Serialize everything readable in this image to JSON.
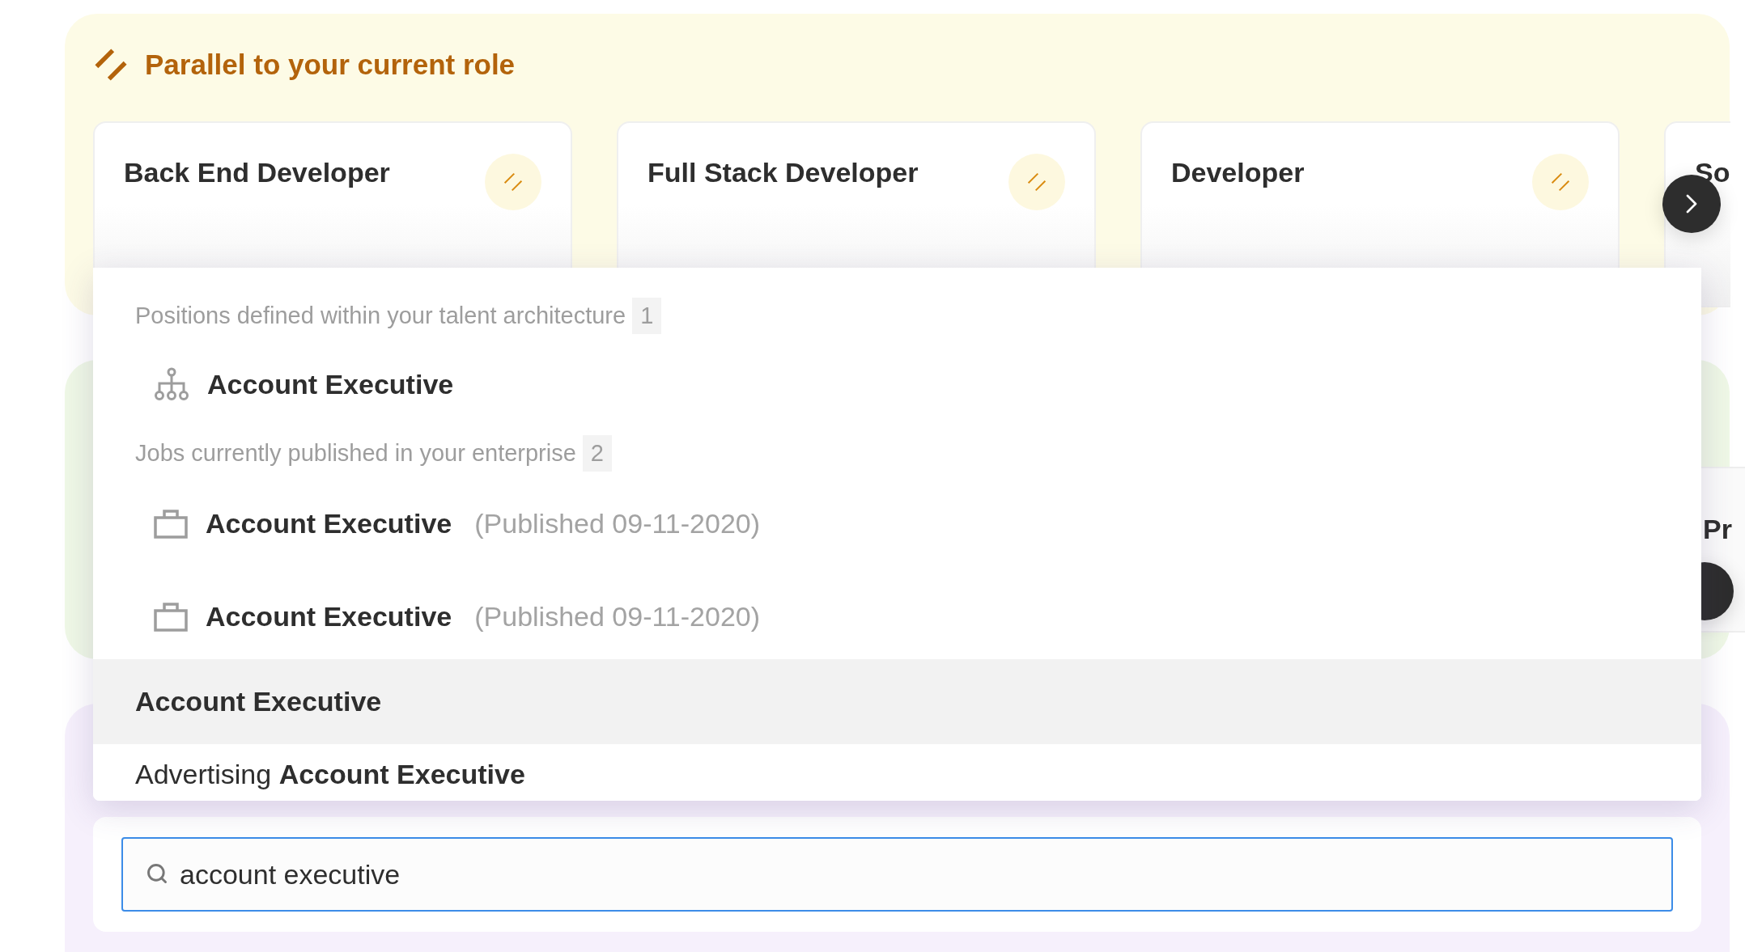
{
  "parallel_section": {
    "title": "Parallel to your current role",
    "cards": [
      {
        "title": "Back End Developer"
      },
      {
        "title": "Full Stack Developer"
      },
      {
        "title": "Developer"
      },
      {
        "title": "So"
      }
    ]
  },
  "second_section": {
    "cards": [
      {
        "title": "Pr"
      }
    ]
  },
  "dropdown": {
    "groups": [
      {
        "kind": "position",
        "heading": "Positions defined within your talent architecture",
        "count": "1",
        "items": [
          {
            "title": "Account Executive"
          }
        ]
      },
      {
        "kind": "job",
        "heading": "Jobs currently published in your enterprise",
        "count": "2",
        "items": [
          {
            "title": "Account Executive",
            "note": "(Published 09-11-2020)"
          },
          {
            "title": "Account Executive",
            "note": "(Published 09-11-2020)"
          }
        ]
      }
    ],
    "suggestions": [
      {
        "match": "Account Executive",
        "selected": true
      },
      {
        "prefix": "Advertising",
        "match": "Account Executive",
        "selected": false
      }
    ]
  },
  "search": {
    "value": "account executive"
  }
}
